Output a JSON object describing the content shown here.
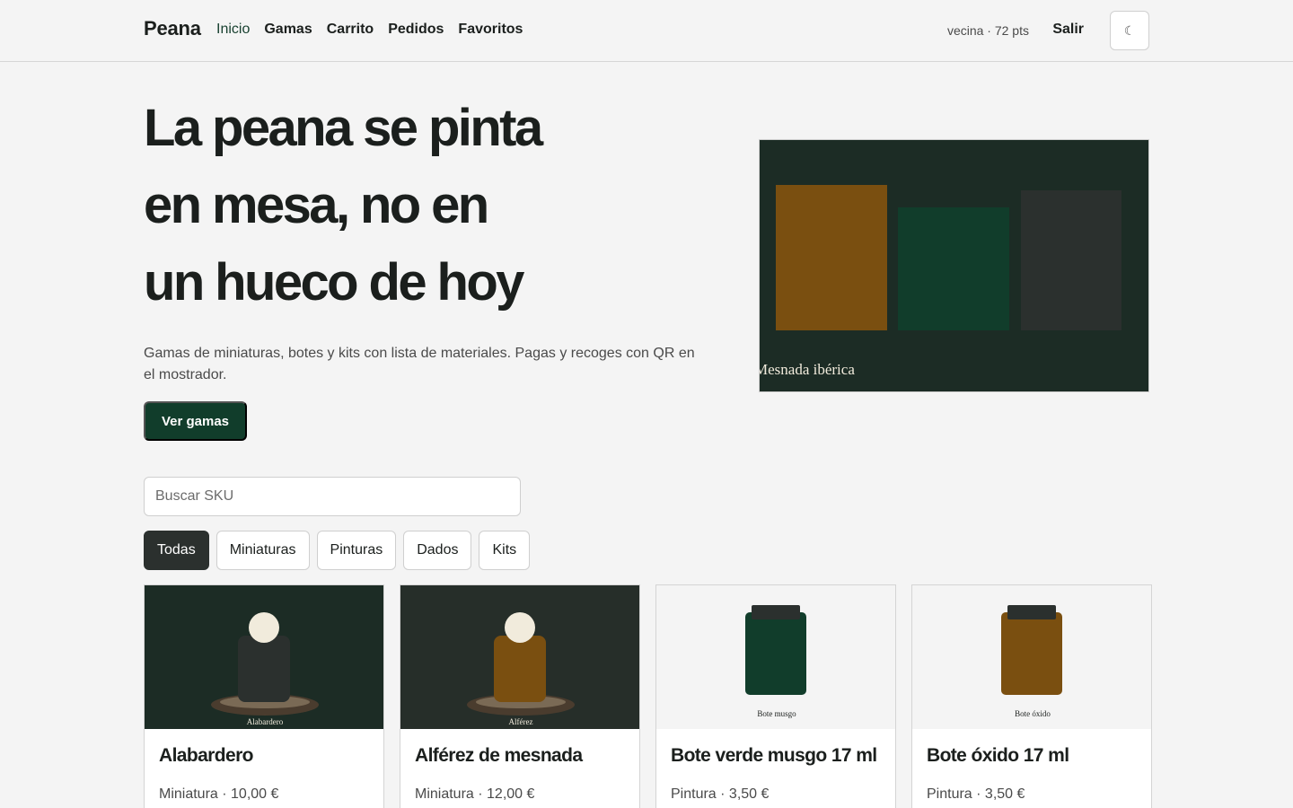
{
  "nav": {
    "brand": "Peana",
    "links": [
      "Inicio",
      "Gamas",
      "Carrito",
      "Pedidos",
      "Favoritos"
    ],
    "active": "Inicio",
    "user_points": "vecina · 72 pts",
    "logout_label": "Salir",
    "theme_toggle_glyph": "☾",
    "theme_toggle_icon": "moon-icon"
  },
  "hero": {
    "title_lines": [
      "La peana se pinta",
      "en mesa, no en",
      "un hueco de hoy"
    ],
    "subtitle": "Gamas de miniaturas, botes y kits con lista de materiales. Pagas y recoges con QR en el mostrador.",
    "cta_label": "Ver gamas",
    "image_caption": "Mesnada ibérica",
    "image_bg": "#1c2c25",
    "image_block_colors": [
      "#7a4f10",
      "#113d2b",
      "#2b302e"
    ]
  },
  "search": {
    "placeholder": "Buscar SKU",
    "value": ""
  },
  "filters": {
    "options": [
      "Todas",
      "Miniaturas",
      "Pinturas",
      "Dados",
      "Kits"
    ],
    "active": "Todas"
  },
  "products": [
    {
      "name": "Alabardero",
      "meta": "Miniatura · 10,00 €",
      "img_label": "Alabardero",
      "kind": "figure",
      "bg": "#1c2c25",
      "body_color": "#2b302e"
    },
    {
      "name": "Alférez de mesnada",
      "meta": "Miniatura · 12,00 €",
      "img_label": "Alférez",
      "kind": "figure",
      "bg": "#262e29",
      "body_color": "#7a4f10"
    },
    {
      "name": "Bote verde musgo 17 ml",
      "meta": "Pintura · 3,50 €",
      "img_label": "Bote musgo",
      "kind": "paint",
      "bg": "#f4f4f4",
      "body_color": "#113d2b"
    },
    {
      "name": "Bote óxido 17 ml",
      "meta": "Pintura · 3,50 €",
      "img_label": "Bote óxido",
      "kind": "paint",
      "bg": "#f4f4f4",
      "body_color": "#7a4f10"
    }
  ],
  "colors": {
    "accent": "#113d2b",
    "text": "#1b1f1d",
    "cream": "#f1ebdc"
  }
}
